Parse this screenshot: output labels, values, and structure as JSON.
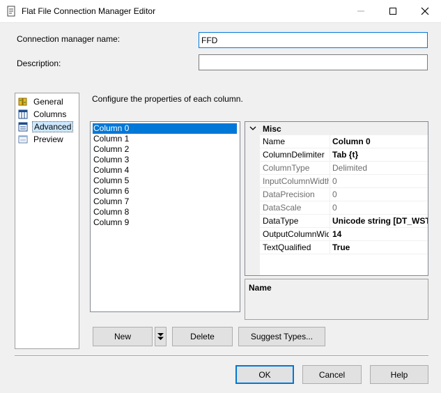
{
  "window": {
    "title": "Flat File Connection Manager Editor"
  },
  "form": {
    "name_label": "Connection manager name:",
    "name_value": "FFD",
    "description_label": "Description:",
    "description_value": ""
  },
  "nav": {
    "items": [
      {
        "label": "General",
        "icon": "general-icon"
      },
      {
        "label": "Columns",
        "icon": "columns-icon"
      },
      {
        "label": "Advanced",
        "icon": "advanced-icon"
      },
      {
        "label": "Preview",
        "icon": "preview-icon"
      }
    ],
    "selected": "Advanced"
  },
  "main": {
    "instruction": "Configure the properties of each column.",
    "columns": [
      "Column 0",
      "Column 1",
      "Column 2",
      "Column 3",
      "Column 4",
      "Column 5",
      "Column 6",
      "Column 7",
      "Column 8",
      "Column 9"
    ],
    "selected_column": "Column 0"
  },
  "properties": {
    "category": "Misc",
    "rows": [
      {
        "name": "Name",
        "value": "Column 0"
      },
      {
        "name": "ColumnDelimiter",
        "value": "Tab {t}"
      },
      {
        "name": "ColumnType",
        "value": "Delimited"
      },
      {
        "name": "InputColumnWidth",
        "value": "0"
      },
      {
        "name": "DataPrecision",
        "value": "0"
      },
      {
        "name": "DataScale",
        "value": "0"
      },
      {
        "name": "DataType",
        "value": "Unicode string [DT_WSTR]"
      },
      {
        "name": "OutputColumnWidth",
        "value": "14"
      },
      {
        "name": "TextQualified",
        "value": "True"
      }
    ],
    "description_title": "Name"
  },
  "buttons": {
    "new": "New",
    "delete": "Delete",
    "suggest": "Suggest Types...",
    "ok": "OK",
    "cancel": "Cancel",
    "help": "Help"
  },
  "colors": {
    "accent": "#0078d7",
    "selection_light": "#cce8ff",
    "dialog_bg": "#f0f0f0"
  }
}
